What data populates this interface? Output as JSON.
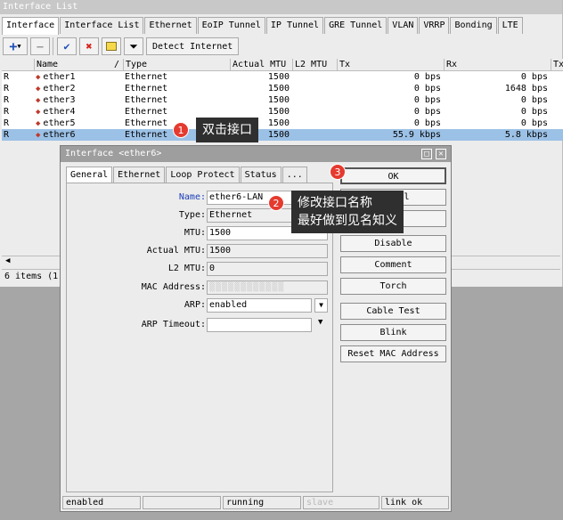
{
  "window": {
    "title": "Interface List"
  },
  "tabs": [
    "Interface",
    "Interface List",
    "Ethernet",
    "EoIP Tunnel",
    "IP Tunnel",
    "GRE Tunnel",
    "VLAN",
    "VRRP",
    "Bonding",
    "LTE"
  ],
  "toolbar": {
    "add_icon": "plus-icon",
    "remove_icon": "minus-icon",
    "enable_icon": "check-icon",
    "disable_icon": "x-icon",
    "comment_icon": "note-icon",
    "filter_icon": "filter-icon",
    "detect_label": "Detect Internet"
  },
  "table": {
    "columns": [
      "",
      "Name",
      "/",
      "Type",
      "Actual MTU",
      "L2 MTU",
      "Tx",
      "Rx",
      "Tx"
    ],
    "rows": [
      {
        "flag": "R",
        "name": "ether1",
        "type": "Ethernet",
        "mtu": "1500",
        "l2mtu": "",
        "tx": "0 bps",
        "rx": "0 bps"
      },
      {
        "flag": "R",
        "name": "ether2",
        "type": "Ethernet",
        "mtu": "1500",
        "l2mtu": "",
        "tx": "0 bps",
        "rx": "1648 bps"
      },
      {
        "flag": "R",
        "name": "ether3",
        "type": "Ethernet",
        "mtu": "1500",
        "l2mtu": "",
        "tx": "0 bps",
        "rx": "0 bps"
      },
      {
        "flag": "R",
        "name": "ether4",
        "type": "Ethernet",
        "mtu": "1500",
        "l2mtu": "",
        "tx": "0 bps",
        "rx": "0 bps"
      },
      {
        "flag": "R",
        "name": "ether5",
        "type": "Ethernet",
        "mtu": "1500",
        "l2mtu": "",
        "tx": "0 bps",
        "rx": "0 bps"
      },
      {
        "flag": "R",
        "name": "ether6",
        "type": "Ethernet",
        "mtu": "1500",
        "l2mtu": "",
        "tx": "55.9 kbps",
        "rx": "5.8 kbps"
      }
    ],
    "items_count": "6 items (1"
  },
  "dialog": {
    "title": "Interface <ether6>",
    "tabs": [
      "General",
      "Ethernet",
      "Loop Protect",
      "Status",
      "..."
    ],
    "fields": {
      "name_label": "Name:",
      "name_value": "ether6-LAN",
      "type_label": "Type:",
      "type_value": "Ethernet",
      "mtu_label": "MTU:",
      "mtu_value": "1500",
      "actual_mtu_label": "Actual MTU:",
      "actual_mtu_value": "1500",
      "l2mtu_label": "L2 MTU:",
      "l2mtu_value": "0",
      "mac_label": "MAC Address:",
      "arp_label": "ARP:",
      "arp_value": "enabled",
      "arp_timeout_label": "ARP Timeout:"
    },
    "buttons": {
      "ok": "OK",
      "cancel": "Cancel",
      "disable": "Disable",
      "comment": "Comment",
      "torch": "Torch",
      "cable_test": "Cable Test",
      "blink": "Blink",
      "reset_mac": "Reset MAC Address"
    },
    "status": [
      "enabled",
      "",
      "running",
      "slave",
      "link ok"
    ]
  },
  "annotations": {
    "badge1": "1",
    "callout1": "双击接口",
    "badge2": "2",
    "callout2_line1": "修改接口名称",
    "callout2_line2": "最好做到见名知义",
    "badge3": "3"
  },
  "colors": {
    "selected_row": "#9cc1e6",
    "badge": "#e53a2f",
    "label_blue": "#1c3fb8"
  }
}
